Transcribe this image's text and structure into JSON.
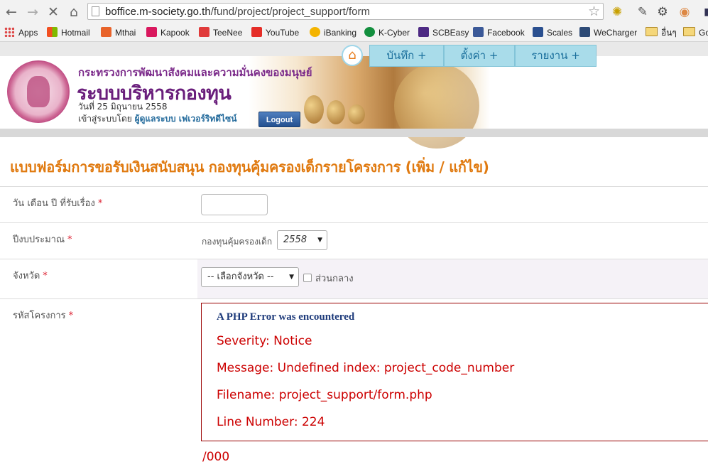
{
  "browser": {
    "url_host": "boffice.m-society.go.th",
    "url_path": "/fund/project/project_support/form",
    "bookmarks": [
      {
        "label": "Apps",
        "color": "#d44"
      },
      {
        "label": "Hotmail",
        "color": "#f25022"
      },
      {
        "label": "Mthai",
        "color": "#e8632a"
      },
      {
        "label": "Kapook",
        "color": "#d9185e"
      },
      {
        "label": "TeeNee",
        "color": "#e03a3a"
      },
      {
        "label": "YouTube",
        "color": "#e52d27"
      },
      {
        "label": "iBanking",
        "color": "#f4b400"
      },
      {
        "label": "K-Cyber",
        "color": "#138f3e"
      },
      {
        "label": "SCBEasy",
        "color": "#4e2a84"
      },
      {
        "label": "Facebook",
        "color": "#3b5998"
      },
      {
        "label": "Scales",
        "color": "#2a4f8f"
      },
      {
        "label": "WeCharger",
        "color": "#2d4a76"
      },
      {
        "label": "อื่นๆ",
        "color": "#f5d77a"
      },
      {
        "label": "Go",
        "color": "#f5d77a"
      }
    ]
  },
  "header": {
    "ministry": "กระทรวงการพัฒนาสังคมและความมั่นคงของมนุษย์",
    "system_name": "ระบบบริหารกองทุน",
    "date": "วันที่ 25 มิถุนายน 2558",
    "login_prefix": "เข้าสู่ระบบโดย",
    "login_user": "ผู้ดูแลระบบ เฟเวอร์ริทดีไซน์",
    "logout": "Logout"
  },
  "menu": [
    {
      "label": "บันทึก +"
    },
    {
      "label": "ตั้งค่า +"
    },
    {
      "label": "รายงาน +"
    }
  ],
  "form": {
    "title": "แบบฟอร์มการขอรับเงินสนับสนุน กองทุนคุ้มครองเด็กรายโครงการ (เพิ่ม / แก้ไข)",
    "req_mark": "*",
    "date_label": "วัน เดือน ปี ที่รับเรื่อง",
    "date_value": "",
    "fiscal_label": "ปีงบประมาณ",
    "fund_label": "กองทุนคุ้มครองเด็ก",
    "fiscal_year": "2558",
    "province_label": "จังหวัด",
    "province_select": "-- เลือกจังหวัด --",
    "central_label": "ส่วนกลาง",
    "project_code_label": "รหัสโครงการ"
  },
  "error": {
    "title": "A PHP Error was encountered",
    "severity": "Severity: Notice",
    "message": "Message: Undefined index: project_code_number",
    "filename": "Filename: project_support/form.php",
    "line": "Line Number: 224",
    "suffix": "/000"
  }
}
